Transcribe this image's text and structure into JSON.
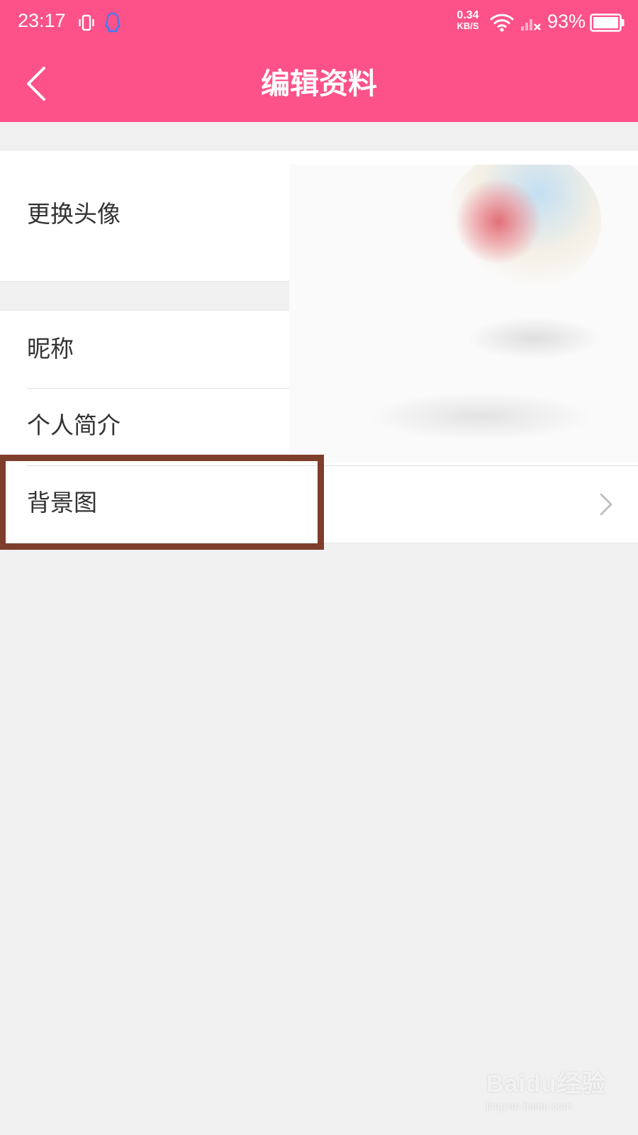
{
  "status_bar": {
    "time": "23:17",
    "net_speed_value": "0.34",
    "net_speed_unit": "KB/S",
    "battery_percent": "93%",
    "icons": [
      "vibrate-icon",
      "qq-icon",
      "wifi-icon",
      "signal-off-icon",
      "battery-icon"
    ]
  },
  "header": {
    "back_icon": "chevron-left-icon",
    "title": "编辑资料"
  },
  "profile_rows": {
    "avatar_label": "更换头像",
    "nickname_label": "昵称",
    "bio_label": "个人简介",
    "background_label": "背景图"
  },
  "watermark": {
    "logo_text": "Baidu经验",
    "url": "jingyan.baidu.com"
  },
  "colors": {
    "accent": "#fd5189",
    "highlight_border": "#7e3e2c",
    "page_background": "#f0f0f0"
  }
}
